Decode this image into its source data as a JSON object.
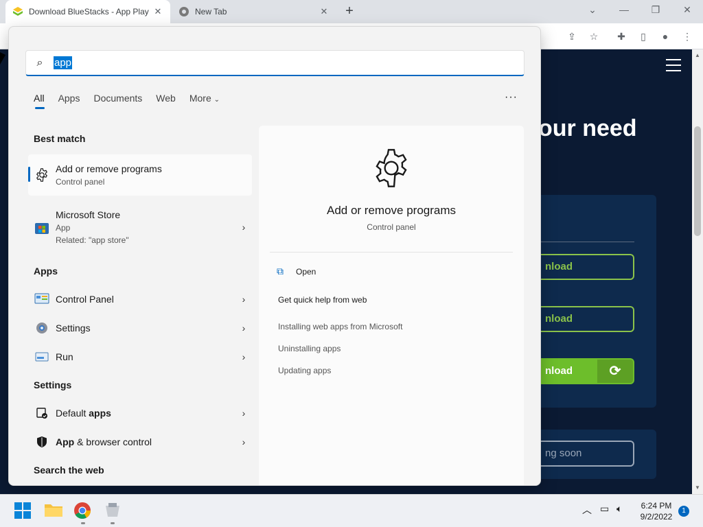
{
  "browser": {
    "tabs": [
      {
        "title": "Download BlueStacks - App Play",
        "close": "✕"
      },
      {
        "title": "New Tab",
        "close": "✕"
      }
    ],
    "new_tab": "+",
    "window_controls": {
      "tab_search": "⌄",
      "minimize": "—",
      "restore": "❐",
      "close": "✕"
    }
  },
  "webpage": {
    "heading": "our need",
    "buttons": [
      "nload",
      "nload",
      "nload",
      "ng soon"
    ]
  },
  "search": {
    "query": "app",
    "filters": [
      "All",
      "Apps",
      "Documents",
      "Web",
      "More"
    ],
    "more_menu": "···"
  },
  "left": {
    "best_match_heading": "Best match",
    "best_match": {
      "title": "Add or remove programs",
      "subtitle": "Control panel"
    },
    "store": {
      "title": "Microsoft Store",
      "type": "App",
      "related": "Related: \"app store\""
    },
    "apps_heading": "Apps",
    "apps": [
      "Control Panel",
      "Settings",
      "Run"
    ],
    "settings_heading": "Settings",
    "settings": [
      {
        "before": "Default ",
        "bold": "apps",
        "after": ""
      },
      {
        "before": "",
        "bold": "App",
        "after": " & browser control"
      }
    ],
    "web_heading": "Search the web"
  },
  "preview": {
    "title": "Add or remove programs",
    "subtitle": "Control panel",
    "open_label": "Open",
    "help_heading": "Get quick help from web",
    "links": [
      "Installing web apps from Microsoft",
      "Uninstalling apps",
      "Updating apps"
    ]
  },
  "taskbar": {
    "time": "6:24 PM",
    "date": "9/2/2022",
    "notifications": "1"
  },
  "colors": {
    "accent": "#0067c0",
    "web_bg": "#0b1a33",
    "download_green": "#8bc34a"
  }
}
